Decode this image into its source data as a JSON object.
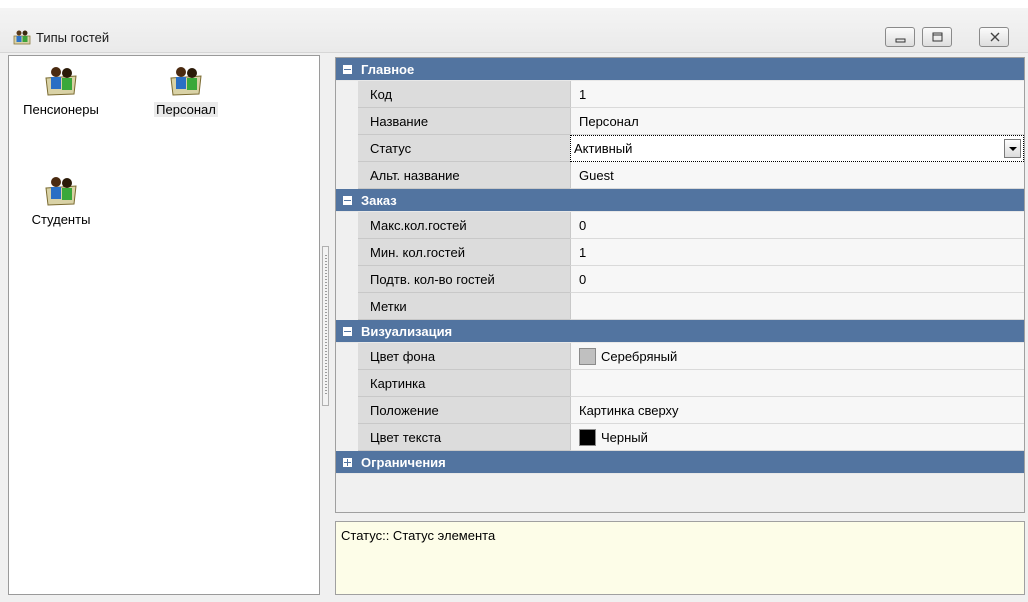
{
  "window": {
    "title": "Типы гостей"
  },
  "groups": [
    {
      "label": "Пенсионеры",
      "icon": "people-group-icon"
    },
    {
      "label": "Персонал",
      "icon": "people-group-icon"
    },
    {
      "label": "Студенты",
      "icon": "people-group-icon"
    }
  ],
  "properties": {
    "categories": [
      {
        "title": "Главное",
        "expanded": true,
        "rows": [
          {
            "name": "Код",
            "value": "1"
          },
          {
            "name": "Название",
            "value": "Персонал"
          },
          {
            "name": "Статус",
            "value": "Активный"
          },
          {
            "name": "Альт. название",
            "value": "Guest"
          }
        ]
      },
      {
        "title": "Заказ",
        "expanded": true,
        "rows": [
          {
            "name": "Макс.кол.гостей",
            "value": "0"
          },
          {
            "name": "Мин. кол.гостей",
            "value": "1"
          },
          {
            "name": "Подтв. кол-во гостей",
            "value": "0"
          },
          {
            "name": "Метки",
            "value": ""
          }
        ]
      },
      {
        "title": "Визуализация",
        "expanded": true,
        "rows": [
          {
            "name": "Цвет фона",
            "value": "Серебряный",
            "swatch": "#c0c0c0"
          },
          {
            "name": "Картинка",
            "value": ""
          },
          {
            "name": "Положение",
            "value": "Картинка сверху"
          },
          {
            "name": "Цвет текста",
            "value": "Черный",
            "swatch": "#000000"
          }
        ]
      },
      {
        "title": "Ограничения",
        "expanded": false,
        "rows": []
      }
    ]
  },
  "description": "Статус:: Статус элемента"
}
